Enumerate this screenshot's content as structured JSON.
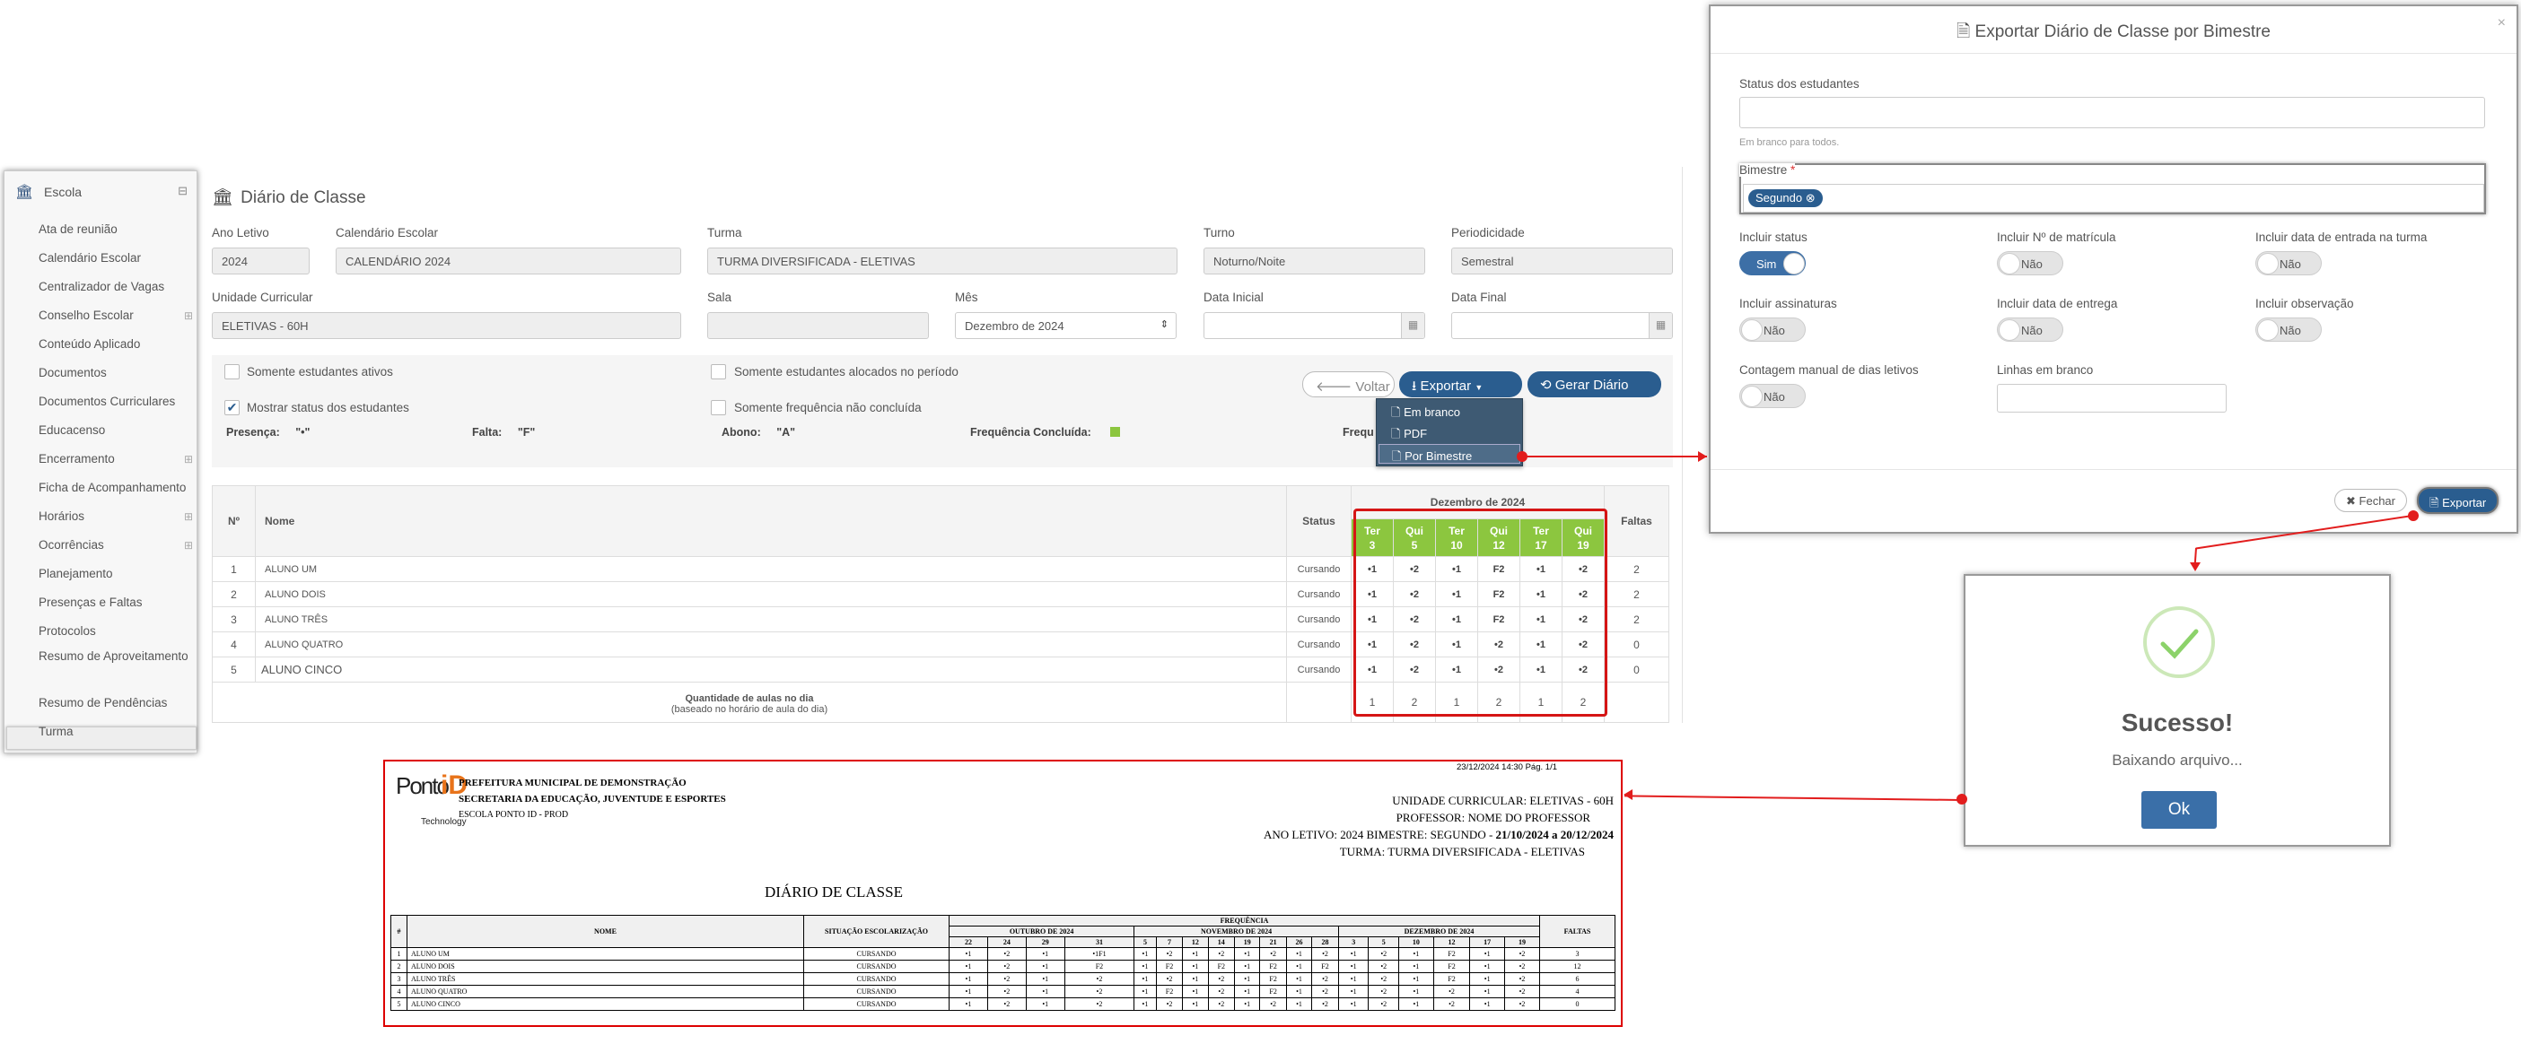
{
  "sidebar": {
    "section": "Escola",
    "items": [
      "Ata de reunião",
      "Calendário Escolar",
      "Centralizador de Vagas",
      "Conselho Escolar",
      "Conteúdo Aplicado",
      "Documentos",
      "Documentos Curriculares",
      "Educacenso",
      "Encerramento",
      "Ficha de Acompanhamento",
      "Horários",
      "Ocorrências",
      "Planejamento",
      "Presenças e Faltas",
      "Protocolos",
      "Resumo de Aproveitamento",
      "Resumo de Pendências",
      "Turma"
    ]
  },
  "page": {
    "title": "Diário de Classe",
    "fields": {
      "ano_letivo": {
        "label": "Ano Letivo",
        "value": "2024"
      },
      "calendario": {
        "label": "Calendário Escolar",
        "value": "CALENDÁRIO 2024"
      },
      "turma": {
        "label": "Turma",
        "value": "TURMA DIVERSIFICADA - ELETIVAS"
      },
      "turno": {
        "label": "Turno",
        "value": "Noturno/Noite"
      },
      "periodicidade": {
        "label": "Periodicidade",
        "value": "Semestral"
      },
      "unidade": {
        "label": "Unidade Curricular",
        "value": "ELETIVAS - 60H"
      },
      "sala": {
        "label": "Sala",
        "value": ""
      },
      "mes": {
        "label": "Mês",
        "value": "Dezembro de 2024"
      },
      "data_inicial": {
        "label": "Data Inicial",
        "value": ""
      },
      "data_final": {
        "label": "Data Final",
        "value": ""
      }
    },
    "checks": {
      "ativos": "Somente estudantes ativos",
      "alocados": "Somente estudantes alocados no período",
      "mostrar": "Mostrar status dos estudantes",
      "nao_concluida": "Somente frequência não concluída"
    },
    "legend": {
      "presenca": "Presença:",
      "presenca_v": "\"•\"",
      "falta": "Falta:",
      "falta_v": "\"F\"",
      "abono": "Abono:",
      "abono_v": "\"A\"",
      "concluida": "Frequência Concluída:",
      "frequ": "Frequ"
    },
    "buttons": {
      "voltar": "Voltar",
      "exportar": "Exportar",
      "gerar": "Gerar Diário"
    },
    "export_menu": [
      "Em branco",
      "PDF",
      "Por Bimestre"
    ]
  },
  "table": {
    "h_num": "Nº",
    "h_nome": "Nome",
    "h_status": "Status",
    "h_month": "Dezembro de 2024",
    "h_faltas": "Faltas",
    "days": [
      {
        "d": "Ter",
        "n": "3"
      },
      {
        "d": "Qui",
        "n": "5"
      },
      {
        "d": "Ter",
        "n": "10"
      },
      {
        "d": "Qui",
        "n": "12"
      },
      {
        "d": "Ter",
        "n": "17"
      },
      {
        "d": "Qui",
        "n": "19"
      }
    ],
    "rows": [
      {
        "n": "1",
        "nome": "ALUNO UM",
        "status": "Cursando",
        "c": [
          "•1",
          "•2",
          "•1",
          "F2",
          "•1",
          "•2"
        ],
        "f": "2"
      },
      {
        "n": "2",
        "nome": "ALUNO DOIS",
        "status": "Cursando",
        "c": [
          "•1",
          "•2",
          "•1",
          "F2",
          "•1",
          "•2"
        ],
        "f": "2"
      },
      {
        "n": "3",
        "nome": "ALUNO TRÊS",
        "status": "Cursando",
        "c": [
          "•1",
          "•2",
          "•1",
          "F2",
          "•1",
          "•2"
        ],
        "f": "2"
      },
      {
        "n": "4",
        "nome": "ALUNO QUATRO",
        "status": "Cursando",
        "c": [
          "•1",
          "•2",
          "•1",
          "•2",
          "•1",
          "•2"
        ],
        "f": "0"
      },
      {
        "n": "5",
        "nome": "ALUNO CINCO",
        "status": "Cursando",
        "c": [
          "•1",
          "•2",
          "•1",
          "•2",
          "•1",
          "•2"
        ],
        "f": "0"
      }
    ],
    "qtd_label": "Quantidade de aulas no dia",
    "qtd_sub": "(baseado no horário de aula do dia)",
    "qtd": [
      "1",
      "2",
      "1",
      "2",
      "1",
      "2"
    ]
  },
  "modal": {
    "title": "Exportar Diário de Classe por Bimestre",
    "status_label": "Status dos estudantes",
    "status_help": "Em branco para todos.",
    "bimestre_label": "Bimestre",
    "bimestre_tag": "Segundo",
    "opts": [
      {
        "label": "Incluir status",
        "val": "Sim",
        "on": true
      },
      {
        "label": "Incluir Nº de matrícula",
        "val": "Não",
        "on": false
      },
      {
        "label": "Incluir data de entrada na turma",
        "val": "Não",
        "on": false
      },
      {
        "label": "Incluir assinaturas",
        "val": "Não",
        "on": false
      },
      {
        "label": "Incluir data de entrega",
        "val": "Não",
        "on": false
      },
      {
        "label": "Incluir observação",
        "val": "Não",
        "on": false
      },
      {
        "label": "Contagem manual de dias letivos",
        "val": "Não",
        "on": false
      }
    ],
    "linhas_label": "Linhas em branco",
    "fechar": "Fechar",
    "exportar": "Exportar"
  },
  "success": {
    "title": "Sucesso!",
    "msg": "Baixando arquivo...",
    "ok": "Ok"
  },
  "doc": {
    "stamp": "23/12/2024 14:30   Pág. 1/1",
    "logo_a": "Ponto",
    "logo_b": "iD",
    "logo_c": "Technology",
    "h1": "PREFEITURA MUNICIPAL DE DEMONSTRAÇÃO",
    "h2": "SECRETARIA DA EDUCAÇÃO, JUVENTUDE E ESPORTES",
    "h3": "ESCOLA PONTO ID - PROD",
    "r1": "UNIDADE CURRICULAR: ELETIVAS - 60H",
    "r2": "PROFESSOR: NOME DO PROFESSOR",
    "r3a": "ANO LETIVO: 2024   BIMESTRE: SEGUNDO - ",
    "r3b": "21/10/2024 a 20/12/2024",
    "r4": "TURMA: TURMA DIVERSIFICADA - ELETIVAS",
    "title": "DIÁRIO DE CLASSE",
    "h_num": "#",
    "h_nome": "NOME",
    "h_sit": "SITUAÇÃO ESCOLARIZAÇÃO",
    "h_freq": "FREQUÊNCIA",
    "h_faltas": "FALTAS",
    "months": [
      {
        "name": "OUTUBRO DE 2024",
        "span": 4
      },
      {
        "name": "NOVEMBRO DE 2024",
        "span": 8
      },
      {
        "name": "DEZEMBRO DE 2024",
        "span": 6
      }
    ],
    "days": [
      "22",
      "24",
      "29",
      "31",
      "5",
      "7",
      "12",
      "14",
      "19",
      "21",
      "26",
      "28",
      "3",
      "5",
      "10",
      "12",
      "17",
      "19"
    ],
    "rows": [
      {
        "n": "1",
        "nome": "ALUNO UM",
        "sit": "CURSANDO",
        "c": [
          "•1",
          "•2",
          "•1",
          "•1F1",
          "•1",
          "•2",
          "•1",
          "•2",
          "•1",
          "•2",
          "•1",
          "•2",
          "•1",
          "•2",
          "•1",
          "F2",
          "•1",
          "•2"
        ],
        "f": "3"
      },
      {
        "n": "2",
        "nome": "ALUNO DOIS",
        "sit": "CURSANDO",
        "c": [
          "•1",
          "•2",
          "•1",
          "F2",
          "•1",
          "F2",
          "•1",
          "F2",
          "•1",
          "F2",
          "•1",
          "F2",
          "•1",
          "•2",
          "•1",
          "F2",
          "•1",
          "•2"
        ],
        "f": "12"
      },
      {
        "n": "3",
        "nome": "ALUNO TRÊS",
        "sit": "CURSANDO",
        "c": [
          "•1",
          "•2",
          "•1",
          "•2",
          "•1",
          "•2",
          "•1",
          "•2",
          "•1",
          "F2",
          "•1",
          "•2",
          "•1",
          "•2",
          "•1",
          "F2",
          "•1",
          "•2"
        ],
        "f": "6"
      },
      {
        "n": "4",
        "nome": "ALUNO QUATRO",
        "sit": "CURSANDO",
        "c": [
          "•1",
          "•2",
          "•1",
          "•2",
          "•1",
          "F2",
          "•1",
          "•2",
          "•1",
          "F2",
          "•1",
          "•2",
          "•1",
          "•2",
          "•1",
          "•2",
          "•1",
          "•2"
        ],
        "f": "4"
      },
      {
        "n": "5",
        "nome": "ALUNO CINCO",
        "sit": "CURSANDO",
        "c": [
          "•1",
          "•2",
          "•1",
          "•2",
          "•1",
          "•2",
          "•1",
          "•2",
          "•1",
          "•2",
          "•1",
          "•2",
          "•1",
          "•2",
          "•1",
          "•2",
          "•1",
          "•2"
        ],
        "f": "0"
      }
    ]
  }
}
